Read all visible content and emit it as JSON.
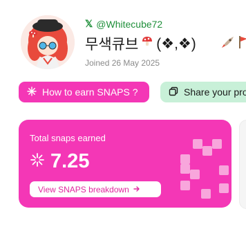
{
  "profile": {
    "handle": "@Whitecube72",
    "display_name": "무색큐브",
    "name_suffix": "(❖,❖)",
    "joined": "Joined 26 May 2025"
  },
  "buttons": {
    "earn_label": "How to earn SNAPS ?",
    "share_label": "Share your pro"
  },
  "card": {
    "title": "Total snaps earned",
    "value": "7.25",
    "breakdown_label": "View SNAPS breakdown"
  },
  "colors": {
    "brand_pink": "#f437b6",
    "share_green": "#c8f0d8",
    "handle_green": "#1f8f3a"
  }
}
